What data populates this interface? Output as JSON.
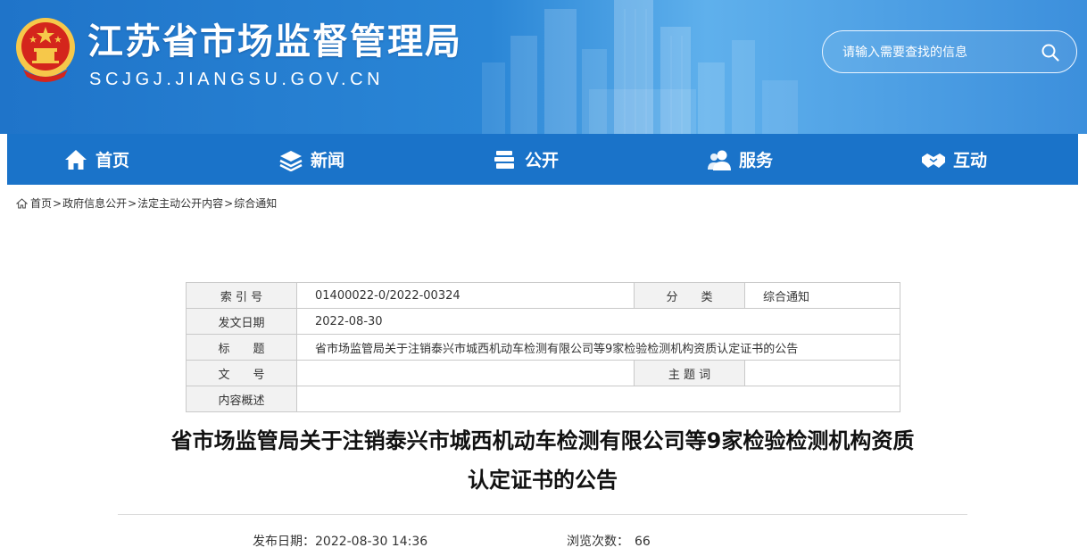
{
  "header": {
    "site_title": "江苏省市场监督管理局",
    "site_domain": "SCJGJ.JIANGSU.GOV.CN",
    "search_placeholder": "请输入需要查找的信息"
  },
  "nav": {
    "items": [
      {
        "label": "首页",
        "icon": "home-icon"
      },
      {
        "label": "新闻",
        "icon": "layers-icon"
      },
      {
        "label": "公开",
        "icon": "stack-icon"
      },
      {
        "label": "服务",
        "icon": "users-icon"
      },
      {
        "label": "互动",
        "icon": "handshake-icon"
      }
    ]
  },
  "breadcrumb": {
    "items": [
      "首页",
      "政府信息公开",
      "法定主动公开内容",
      "综合通知"
    ],
    "separator": ">"
  },
  "info_table": {
    "index_label": "索 引 号",
    "index_value": "01400022-0/2022-00324",
    "category_label": "分　　类",
    "category_value": "综合通知",
    "date_label": "发文日期",
    "date_value": "2022-08-30",
    "title_label": "标　　题",
    "title_value": "省市场监管局关于注销泰兴市城西机动车检测有限公司等9家检验检测机构资质认定证书的公告",
    "doc_no_label": "文　　号",
    "doc_no_value": "",
    "subject_label": "主 题 词",
    "subject_value": "",
    "summary_label": "内容概述",
    "summary_value": ""
  },
  "article": {
    "title_line1": "省市场监管局关于注销泰兴市城西机动车检测有限公司等9家检验检测机构资质",
    "title_line2": "认定证书的公告",
    "publish_label": "发布日期：",
    "publish_value": "2022-08-30 14:36",
    "views_label": "浏览次数：",
    "views_value": "66"
  },
  "colors": {
    "nav_bg": "#1a73c9",
    "header_blue": "#2a86d6",
    "emblem_red": "#d4251c",
    "emblem_gold": "#f6c84a"
  }
}
